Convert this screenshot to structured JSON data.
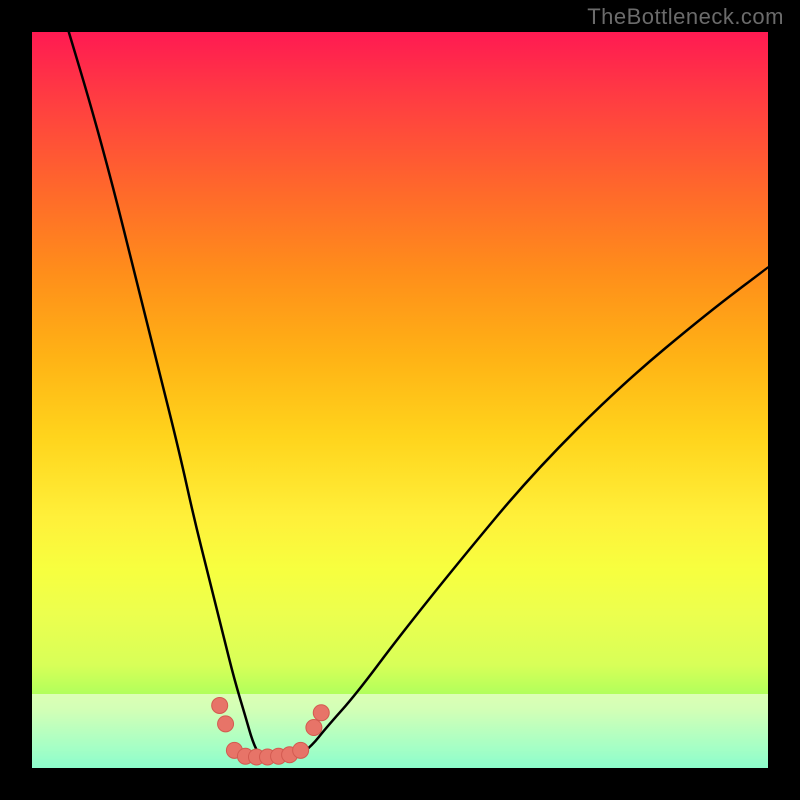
{
  "watermark": {
    "text": "TheBottleneck.com"
  },
  "colors": {
    "frame": "#000000",
    "curve_stroke": "#000000",
    "marker_fill": "#e77468",
    "marker_stroke": "#d35a50"
  },
  "chart_data": {
    "type": "line",
    "title": "",
    "xlabel": "",
    "ylabel": "",
    "xlim": [
      0,
      100
    ],
    "ylim": [
      0,
      100
    ],
    "grid": false,
    "legend": false,
    "series": [
      {
        "name": "bottleneck-curve",
        "x": [
          5,
          8,
          11,
          14,
          17,
          20,
          22,
          24,
          26,
          27.5,
          29,
          30,
          31,
          32,
          34,
          36,
          38,
          40,
          44,
          50,
          58,
          68,
          80,
          92,
          100
        ],
        "y": [
          100,
          90,
          79,
          67,
          55,
          43,
          34,
          26,
          18,
          12,
          7,
          3.5,
          1.5,
          1,
          1,
          1.5,
          3,
          5.5,
          10,
          18,
          28,
          40,
          52,
          62,
          68
        ]
      }
    ],
    "markers": {
      "name": "band-markers",
      "points": [
        {
          "x": 25.5,
          "y": 8.5
        },
        {
          "x": 26.3,
          "y": 6.0
        },
        {
          "x": 27.5,
          "y": 2.4
        },
        {
          "x": 29.0,
          "y": 1.6
        },
        {
          "x": 30.5,
          "y": 1.5
        },
        {
          "x": 32.0,
          "y": 1.5
        },
        {
          "x": 33.5,
          "y": 1.6
        },
        {
          "x": 35.0,
          "y": 1.8
        },
        {
          "x": 36.5,
          "y": 2.4
        },
        {
          "x": 38.3,
          "y": 5.5
        },
        {
          "x": 39.3,
          "y": 7.5
        }
      ]
    },
    "paper_band": {
      "y_from": 0,
      "y_to": 10
    }
  }
}
